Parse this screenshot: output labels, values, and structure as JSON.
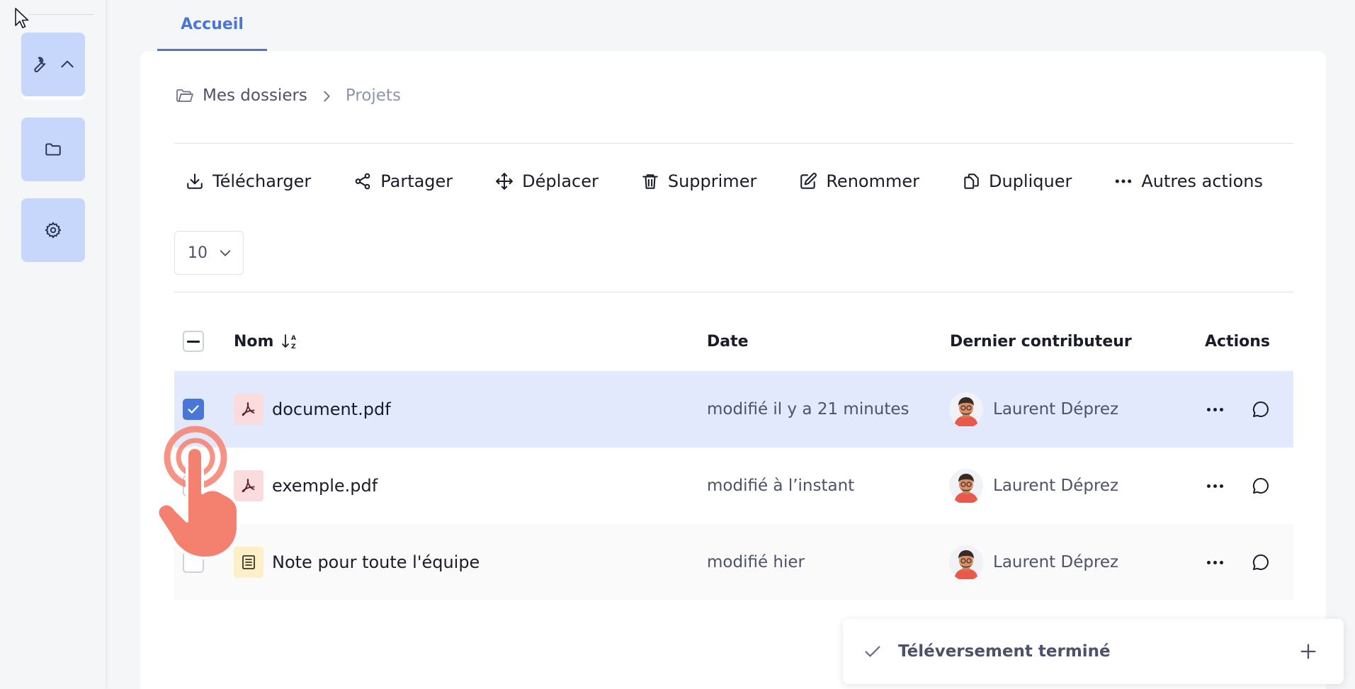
{
  "rail": {
    "items": [
      {
        "icon": "wrench-icon",
        "secondary_icon": "chevron-up-icon"
      },
      {
        "icon": "folder-icon"
      },
      {
        "icon": "gear-icon"
      }
    ]
  },
  "tabs": [
    {
      "label": "Accueil",
      "active": true
    }
  ],
  "breadcrumb": {
    "root": "Mes dossiers",
    "current": "Projets"
  },
  "toolbar": {
    "download": "Télécharger",
    "share": "Partager",
    "move": "Déplacer",
    "delete": "Supprimer",
    "rename": "Renommer",
    "duplicate": "Dupliquer",
    "more": "Autres actions"
  },
  "pagination": {
    "page_size": "10"
  },
  "table": {
    "columns": {
      "name": "Nom",
      "date": "Date",
      "contributor": "Dernier contributeur",
      "actions": "Actions"
    },
    "rows": [
      {
        "name": "document.pdf",
        "type": "pdf",
        "date": "modifié il y a 21 minutes",
        "contributor": "Laurent Déprez",
        "checked": true
      },
      {
        "name": "exemple.pdf",
        "type": "pdf",
        "date": "modifié à l’instant",
        "contributor": "Laurent Déprez",
        "checked": false
      },
      {
        "name": "Note pour toute l'équipe",
        "type": "note",
        "date": "modifié hier",
        "contributor": "Laurent Déprez",
        "checked": false
      }
    ]
  },
  "toast": {
    "message": "Téléversement terminé"
  },
  "colors": {
    "accent": "#4a76d8",
    "rail_button": "#c7d7fb",
    "selected_row": "#e3e9fc",
    "pdf_badge": "#fadcde",
    "note_badge": "#fdf0c9",
    "tap_hand": "#f4806f"
  }
}
